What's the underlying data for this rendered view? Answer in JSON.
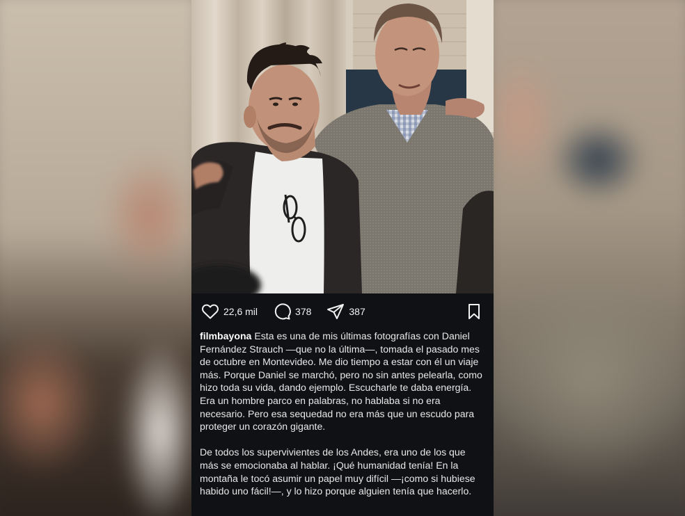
{
  "post": {
    "username": "filmbayona",
    "actions": {
      "likes": "22,6 mil",
      "comments": "378",
      "shares": "387"
    },
    "caption_p1": "Esta es una de mis últimas fotografías con Daniel Fernández Strauch —que no la última—, tomada el pasado mes de octubre en Montevideo. Me dio tiempo a estar con él un viaje más. Porque Daniel se marchó, pero no sin antes pelearla, como hizo toda su vida, dando ejemplo. Escucharle te daba energía. Era un hombre parco en palabras, no hablaba si no era necesario. Pero esa sequedad no era más que un escudo para proteger un corazón gigante.",
    "caption_p2": "De todos los supervivientes de los Andes, era uno de los que más se emocionaba al hablar. ¡Qué humanidad tenía! En la montaña le tocó asumir un papel muy difícil —¡como si hubiese habido uno fácil!—, y lo hizo porque alguien tenía que hacerlo."
  },
  "icons": {
    "like": "heart-icon",
    "comment": "comment-bubble-icon",
    "share": "paper-plane-icon",
    "save": "bookmark-icon"
  },
  "colors": {
    "post_background": "#0f1114",
    "text": "#e8e8e8",
    "username": "#ffffff"
  }
}
